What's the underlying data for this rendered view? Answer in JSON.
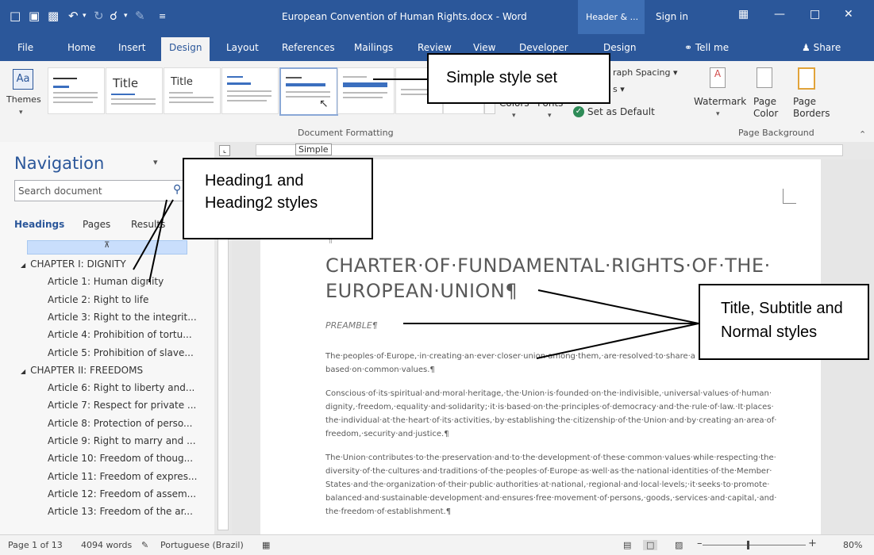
{
  "titlebar": {
    "doc_title": "European Convention of Human Rights.docx - Word",
    "context_tab": "Header & ...",
    "sign_in": "Sign in"
  },
  "tabs": [
    "File",
    "Home",
    "Insert",
    "Design",
    "Layout",
    "References",
    "Mailings",
    "Review",
    "View",
    "Developer"
  ],
  "context_design": "Design",
  "tell_me": "Tell me",
  "share": "Share",
  "ribbon": {
    "themes": "Themes",
    "style_title": "Title",
    "style_title2": "Title",
    "group_doc_formatting": "Document Formatting",
    "colors": "Colors",
    "fonts": "Fonts",
    "paragraph_spacing": "raph Spacing",
    "effects": "s",
    "set_default": "Set as Default",
    "watermark": "Watermark",
    "page_color": "Page Color",
    "page_borders": "Page Borders",
    "group_page_background": "Page Background",
    "simple_tooltip": "Simple"
  },
  "navigation": {
    "title": "Navigation",
    "search_placeholder": "Search document",
    "tabs": [
      "Headings",
      "Pages",
      "Results"
    ],
    "items": [
      {
        "label": "CHAPTER I: DIGNITY",
        "level": 1
      },
      {
        "label": "Article 1: Human dignity",
        "level": 2
      },
      {
        "label": "Article 2: Right to life",
        "level": 2
      },
      {
        "label": "Article 3: Right to the integrit...",
        "level": 2
      },
      {
        "label": "Article 4: Prohibition of tortu...",
        "level": 2
      },
      {
        "label": "Article 5: Prohibition of slave...",
        "level": 2
      },
      {
        "label": "CHAPTER II: FREEDOMS",
        "level": 1
      },
      {
        "label": "Article 6: Right to liberty and...",
        "level": 2
      },
      {
        "label": "Article 7: Respect for private ...",
        "level": 2
      },
      {
        "label": "Article 8: Protection of perso...",
        "level": 2
      },
      {
        "label": "Article 9: Right to marry and ...",
        "level": 2
      },
      {
        "label": "Article 10: Freedom of thoug...",
        "level": 2
      },
      {
        "label": "Article 11: Freedom of expres...",
        "level": 2
      },
      {
        "label": "Article 12: Freedom of assem...",
        "level": 2
      },
      {
        "label": "Article 13: Freedom of the ar...",
        "level": 2
      }
    ]
  },
  "document": {
    "title_line1": "CHARTER·OF·FUNDAMENTAL·RIGHTS·OF·THE·",
    "title_line2": "EUROPEAN·UNION¶",
    "preamble": "PREAMBLE¶",
    "para1": "The·peoples·of·Europe,·in·creating·an·ever·closer·union·among·them,·are·resolved·to·share·a based·on·common·values.¶",
    "para2": "Conscious·of·its·spiritual·and·moral·heritage,·the·Union·is·founded·on·the·indivisible,·universal·values·of·human· dignity,·freedom,·equality·and·solidarity;·it·is·based·on·the·principles·of·democracy·and·the·rule·of·law.·It·places· the·individual·at·the·heart·of·its·activities,·by·establishing·the·citizenship·of·the·Union·and·by·creating·an·area·of· freedom,·security·and·justice.¶",
    "para3": "The·Union·contributes·to·the·preservation·and·to·the·development·of·these·common·values·while·respecting·the· diversity·of·the·cultures·and·traditions·of·the·peoples·of·Europe·as·well·as·the·national·identities·of·the·Member· States·and·the·organization·of·their·public·authorities·at·national,·regional·and·local·levels;·it·seeks·to·promote· balanced·and·sustainable·development·and·ensures·free·movement·of·persons,·goods,·services·and·capital,·and· the·freedom·of·establishment.¶"
  },
  "status": {
    "page": "Page 1 of 13",
    "words": "4094 words",
    "language": "Portuguese (Brazil)",
    "zoom": "80%"
  },
  "callouts": {
    "style_set": "Simple style set",
    "headings_line1": "Heading1 and",
    "headings_line2": "Heading2 styles",
    "title_line1": "Title, Subtitle and",
    "title_line2": "Normal styles"
  },
  "colors": {
    "brand": "#2b579a",
    "nav_highlight": "#c9defc"
  }
}
